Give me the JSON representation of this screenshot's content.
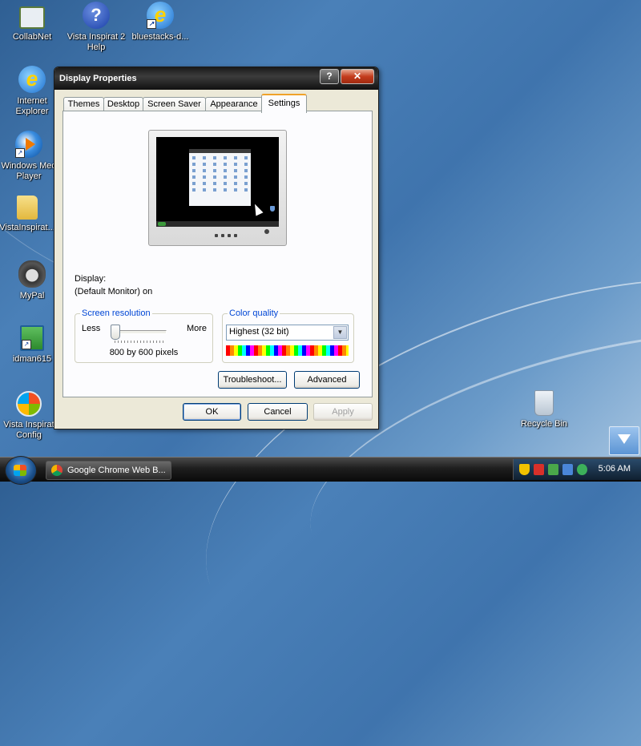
{
  "desktop": {
    "icons": [
      {
        "label": "CollabNet",
        "icon": "collabnet-icon"
      },
      {
        "label": "Vista Inspirat 2 Help",
        "icon": "help-icon"
      },
      {
        "label": "bluestacks-d...",
        "icon": "ie-shortcut-icon"
      },
      {
        "label": "Internet Explorer",
        "icon": "internet-explorer-icon"
      },
      {
        "label": "Windows Med Player",
        "icon": "windows-media-player-icon"
      },
      {
        "label": "VistaInspirat...",
        "icon": "folder-icon"
      },
      {
        "label": "MyPal",
        "icon": "mypal-icon"
      },
      {
        "label": "idman615",
        "icon": "idm-installer-icon"
      },
      {
        "label": "Vista Inspirat Config",
        "icon": "vista-config-icon"
      },
      {
        "label": "Recycle Bin",
        "icon": "recycle-bin-icon"
      }
    ]
  },
  "window": {
    "title": "Display Properties",
    "help_button": "?",
    "close_button": "✕",
    "tabs": [
      {
        "label": "Themes",
        "active": false
      },
      {
        "label": "Desktop",
        "active": false
      },
      {
        "label": "Screen Saver",
        "active": false
      },
      {
        "label": "Appearance",
        "active": false
      },
      {
        "label": "Settings",
        "active": true
      }
    ],
    "settings": {
      "display_label": "Display:",
      "display_value": "(Default Monitor) on",
      "resolution": {
        "group_title": "Screen resolution",
        "less": "Less",
        "more": "More",
        "value_text": "800 by 600 pixels",
        "slider_position": 0
      },
      "color_quality": {
        "group_title": "Color quality",
        "selected": "Highest (32 bit)"
      },
      "troubleshoot_button": "Troubleshoot...",
      "advanced_button": "Advanced"
    },
    "buttons": {
      "ok": "OK",
      "cancel": "Cancel",
      "apply": "Apply"
    }
  },
  "taskbar": {
    "task": "Google Chrome Web B...",
    "clock": "5:06 AM",
    "tray_icons": [
      "security-shield-icon",
      "antivirus-icon",
      "network-icon",
      "volume-icon",
      "sync-icon"
    ]
  }
}
